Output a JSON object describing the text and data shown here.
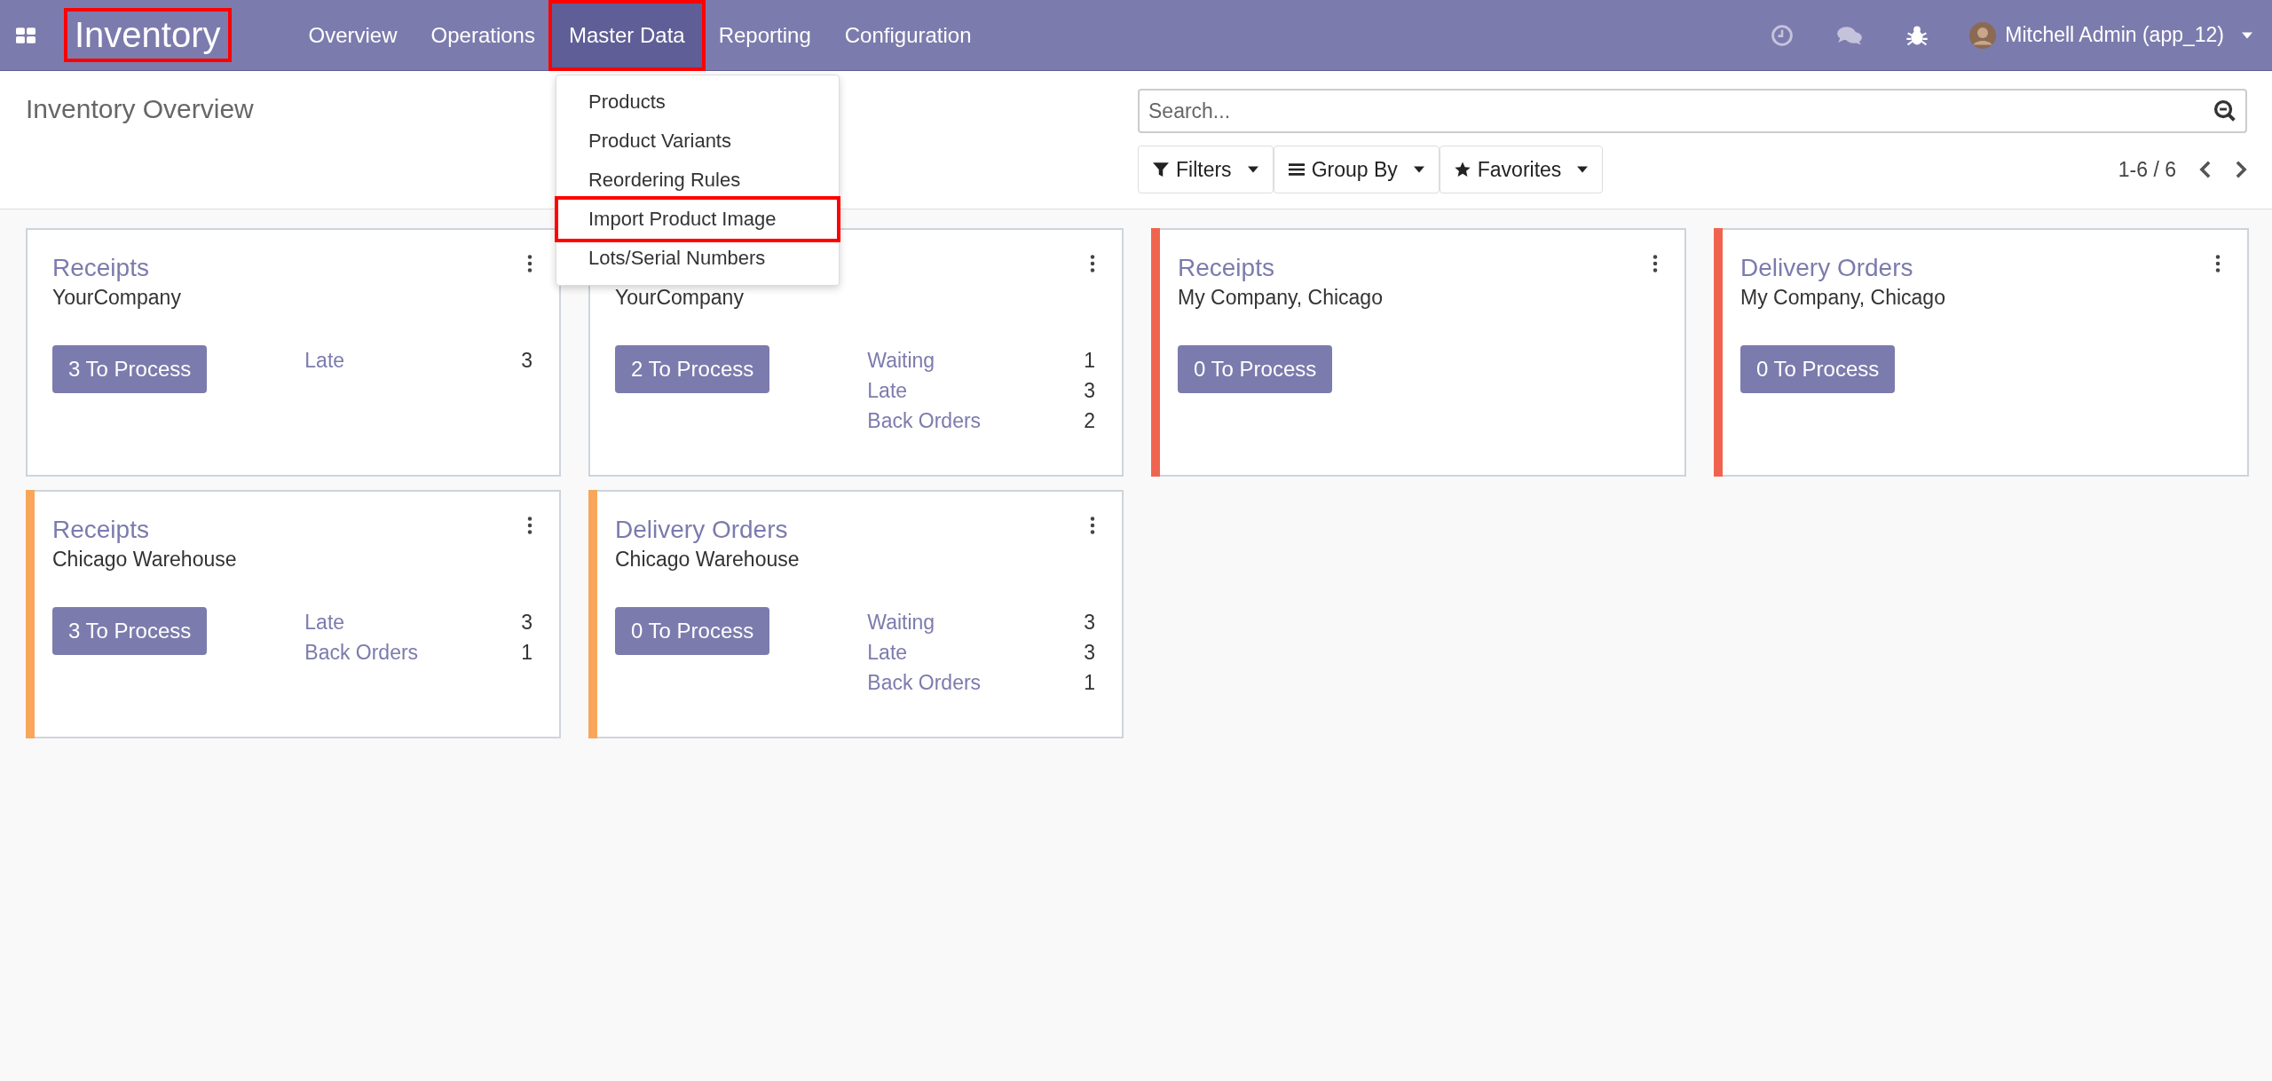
{
  "navbar": {
    "brand": {
      "label": "Inventory",
      "highlighted": true
    },
    "menu": [
      {
        "label": "Overview",
        "selected": false,
        "highlighted": false
      },
      {
        "label": "Operations",
        "selected": false,
        "highlighted": false
      },
      {
        "label": "Master Data",
        "selected": true,
        "highlighted": true
      },
      {
        "label": "Reporting",
        "selected": false,
        "highlighted": false
      },
      {
        "label": "Configuration",
        "selected": false,
        "highlighted": false
      }
    ],
    "dropdown": [
      {
        "label": "Products",
        "highlighted": false
      },
      {
        "label": "Product Variants",
        "highlighted": false
      },
      {
        "label": "Reordering Rules",
        "highlighted": false
      },
      {
        "label": "Import Product Image",
        "highlighted": true
      },
      {
        "label": "Lots/Serial Numbers",
        "highlighted": false
      }
    ],
    "user": {
      "name": "Mitchell Admin (app_12)"
    }
  },
  "control_panel": {
    "title": "Inventory Overview",
    "search": {
      "placeholder": "Search..."
    },
    "buttons": [
      {
        "label": "Filters",
        "kind": "filter"
      },
      {
        "label": "Group By",
        "kind": "group"
      },
      {
        "label": "Favorites",
        "kind": "favorite"
      }
    ],
    "pager": "1-6 / 6"
  },
  "cards": [
    {
      "title": "Receipts",
      "subtitle": "YourCompany",
      "action": "3 To Process",
      "stats": [
        {
          "label": "Late",
          "value": "3"
        }
      ]
    },
    {
      "subtitle": "YourCompany",
      "action": "2 To Process",
      "stats": [
        {
          "label": "Waiting",
          "value": "1"
        },
        {
          "label": "Late",
          "value": "3"
        },
        {
          "label": "Back Orders",
          "value": "2"
        }
      ]
    },
    {
      "title": "Receipts",
      "subtitle": "My Company, Chicago",
      "action": "0 To Process",
      "color": "#f0644f"
    },
    {
      "title": "Delivery Orders",
      "subtitle": "My Company, Chicago",
      "action": "0 To Process",
      "color": "#f0644f"
    },
    {
      "title": "Receipts",
      "subtitle": "Chicago Warehouse",
      "action": "3 To Process",
      "color": "#f7a65c",
      "stats": [
        {
          "label": "Late",
          "value": "3"
        },
        {
          "label": "Back Orders",
          "value": "1"
        }
      ]
    },
    {
      "title": "Delivery Orders",
      "subtitle": "Chicago Warehouse",
      "action": "0 To Process",
      "color": "#f7a65c",
      "stats": [
        {
          "label": "Waiting",
          "value": "3"
        },
        {
          "label": "Late",
          "value": "3"
        },
        {
          "label": "Back Orders",
          "value": "1"
        }
      ]
    }
  ]
}
